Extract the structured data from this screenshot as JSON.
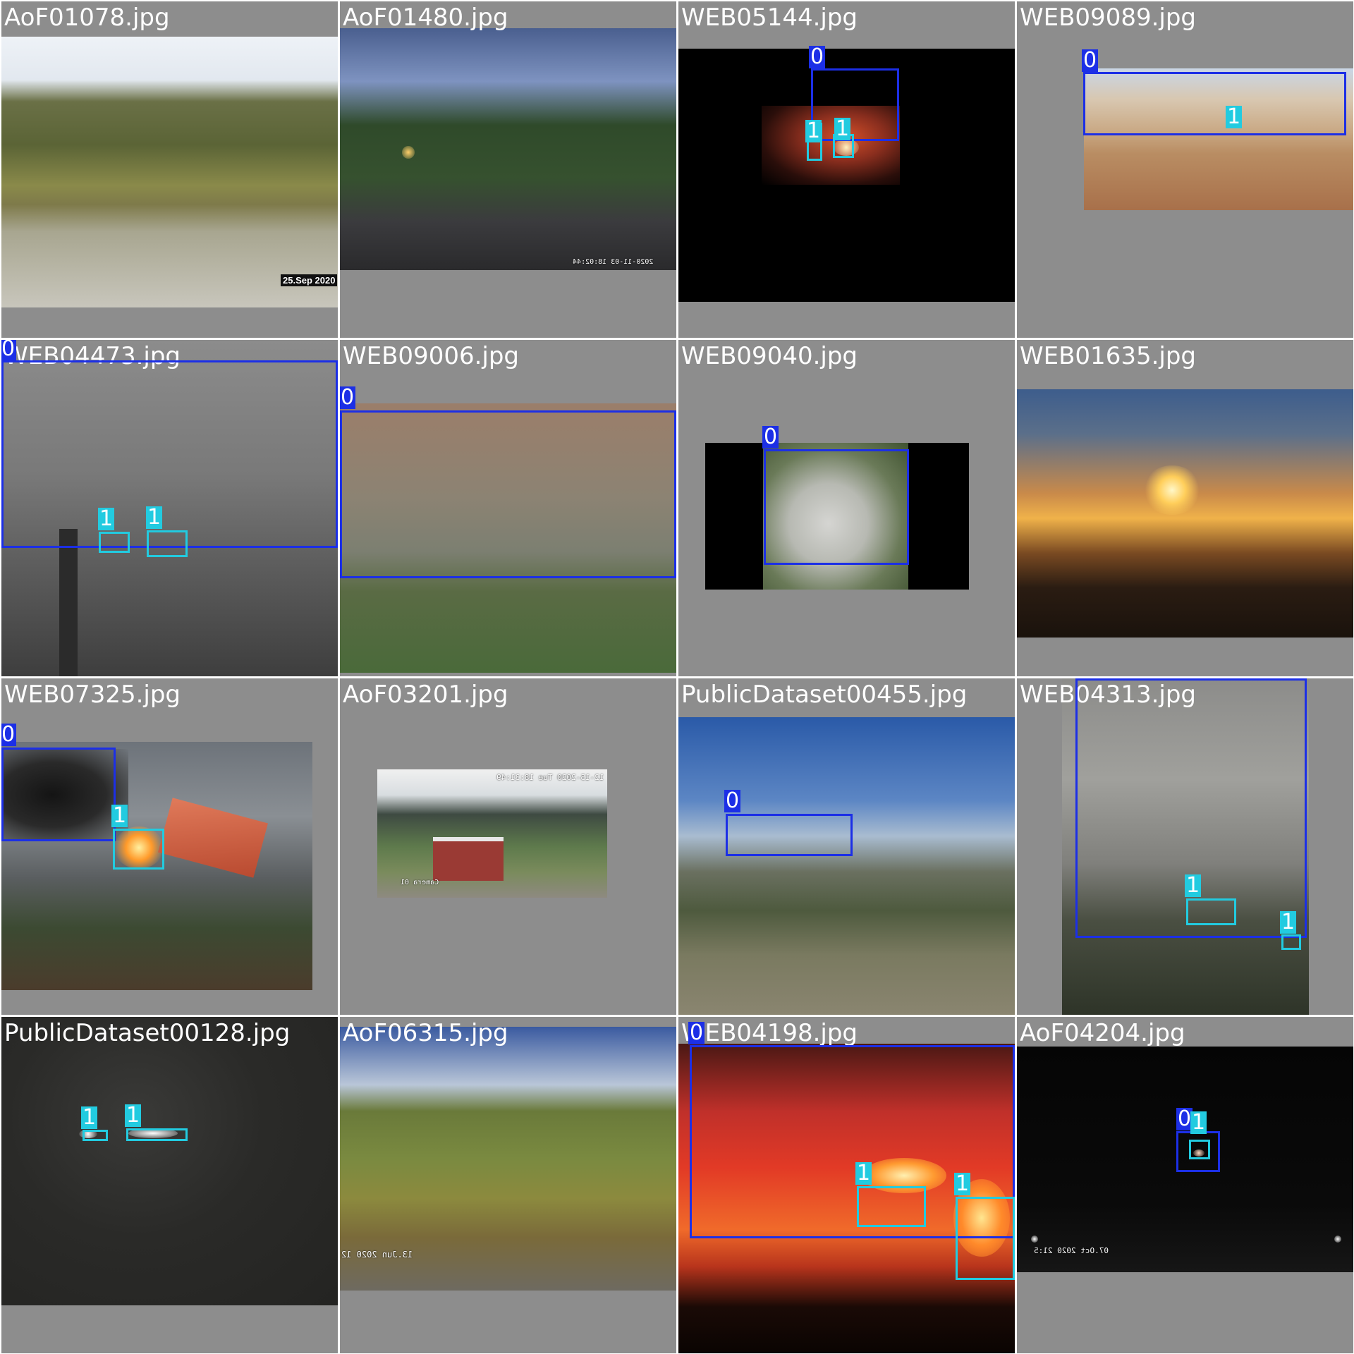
{
  "colors": {
    "class_0_box": "#1c2fe6",
    "class_1_box": "#22cbe0",
    "tile_background": "#8d8d8d",
    "filename_text": "#ffffff"
  },
  "tiles": [
    {
      "filename": "AoF01078.jpg",
      "stamp": "25.Sep 2020",
      "boxes": []
    },
    {
      "filename": "AoF01480.jpg",
      "stamp": "2020-11-03 18:02:44",
      "boxes": []
    },
    {
      "filename": "WEB05144.jpg",
      "boxes": [
        {
          "label": "0"
        },
        {
          "label": "1"
        },
        {
          "label": "1"
        }
      ]
    },
    {
      "filename": "WEB09089.jpg",
      "boxes": [
        {
          "label": "0"
        },
        {
          "label": "1"
        }
      ]
    },
    {
      "filename": "WEB04473.jpg",
      "boxes": [
        {
          "label": "0"
        },
        {
          "label": "1"
        },
        {
          "label": "1"
        }
      ]
    },
    {
      "filename": "WEB09006.jpg",
      "boxes": [
        {
          "label": "0"
        }
      ]
    },
    {
      "filename": "WEB09040.jpg",
      "boxes": [
        {
          "label": "0"
        }
      ]
    },
    {
      "filename": "WEB01635.jpg",
      "boxes": []
    },
    {
      "filename": "WEB07325.jpg",
      "boxes": [
        {
          "label": "0"
        },
        {
          "label": "1"
        }
      ]
    },
    {
      "filename": "AoF03201.jpg",
      "stamp": "12-15-2020 Tue 18:31:49",
      "stamp2": "Camera 01",
      "boxes": []
    },
    {
      "filename": "PublicDataset00455.jpg",
      "boxes": [
        {
          "label": "0"
        }
      ]
    },
    {
      "filename": "WEB04313.jpg",
      "boxes": [
        {
          "label": "0"
        },
        {
          "label": "1"
        },
        {
          "label": "1"
        }
      ]
    },
    {
      "filename": "PublicDataset00128.jpg",
      "boxes": [
        {
          "label": "1"
        },
        {
          "label": "1"
        }
      ]
    },
    {
      "filename": "AoF06315.jpg",
      "stamp": "13.Jun 2020 12",
      "boxes": []
    },
    {
      "filename": "WEB04198.jpg",
      "boxes": [
        {
          "label": "0"
        },
        {
          "label": "1"
        },
        {
          "label": "1"
        }
      ]
    },
    {
      "filename": "AoF04204.jpg",
      "stamp": "07.Oct 2020 21:5",
      "boxes": [
        {
          "label": "0"
        },
        {
          "label": "1"
        }
      ]
    }
  ]
}
